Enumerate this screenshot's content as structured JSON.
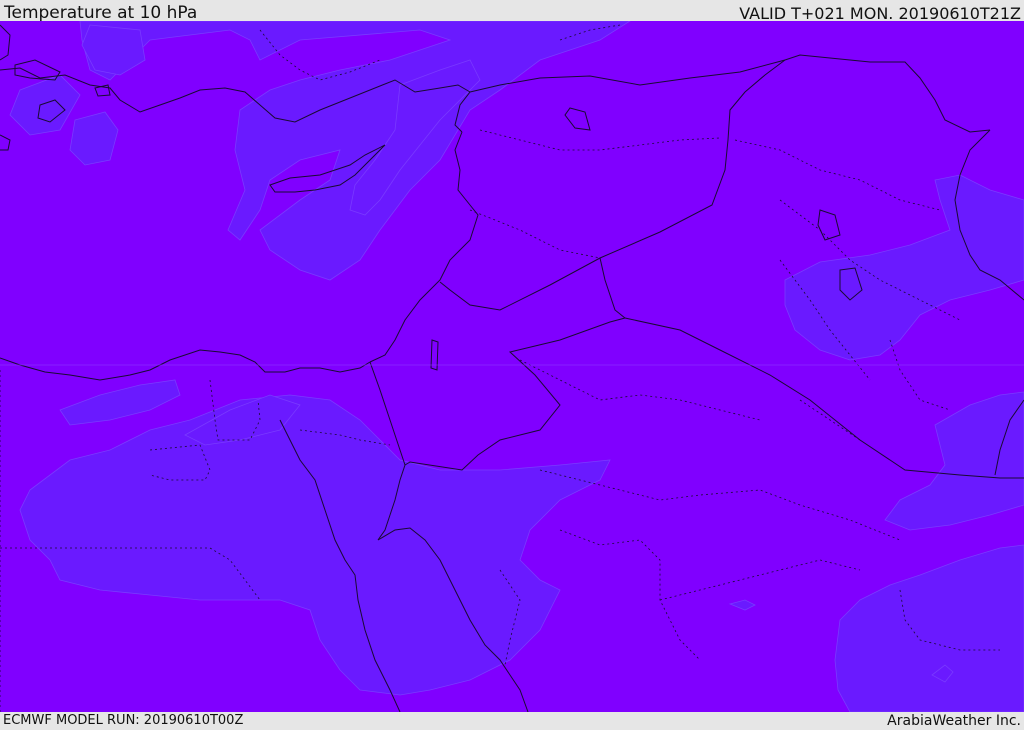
{
  "header": {
    "title": "Temperature at 10 hPa",
    "valid": "VALID T+021 MON. 20190610T21Z"
  },
  "footer": {
    "model_run": "ECMWF MODEL RUN: 20190610T00Z",
    "credit": "ArabiaWeather Inc."
  },
  "colors": {
    "background_field": "#8000ff",
    "cooler_field": "#6a1aff",
    "coastline": "#1a0a33",
    "frame": "#e6e6e6"
  },
  "map": {
    "variable": "temperature",
    "level": "10 hPa",
    "region": "Eastern Mediterranean / Middle East"
  }
}
